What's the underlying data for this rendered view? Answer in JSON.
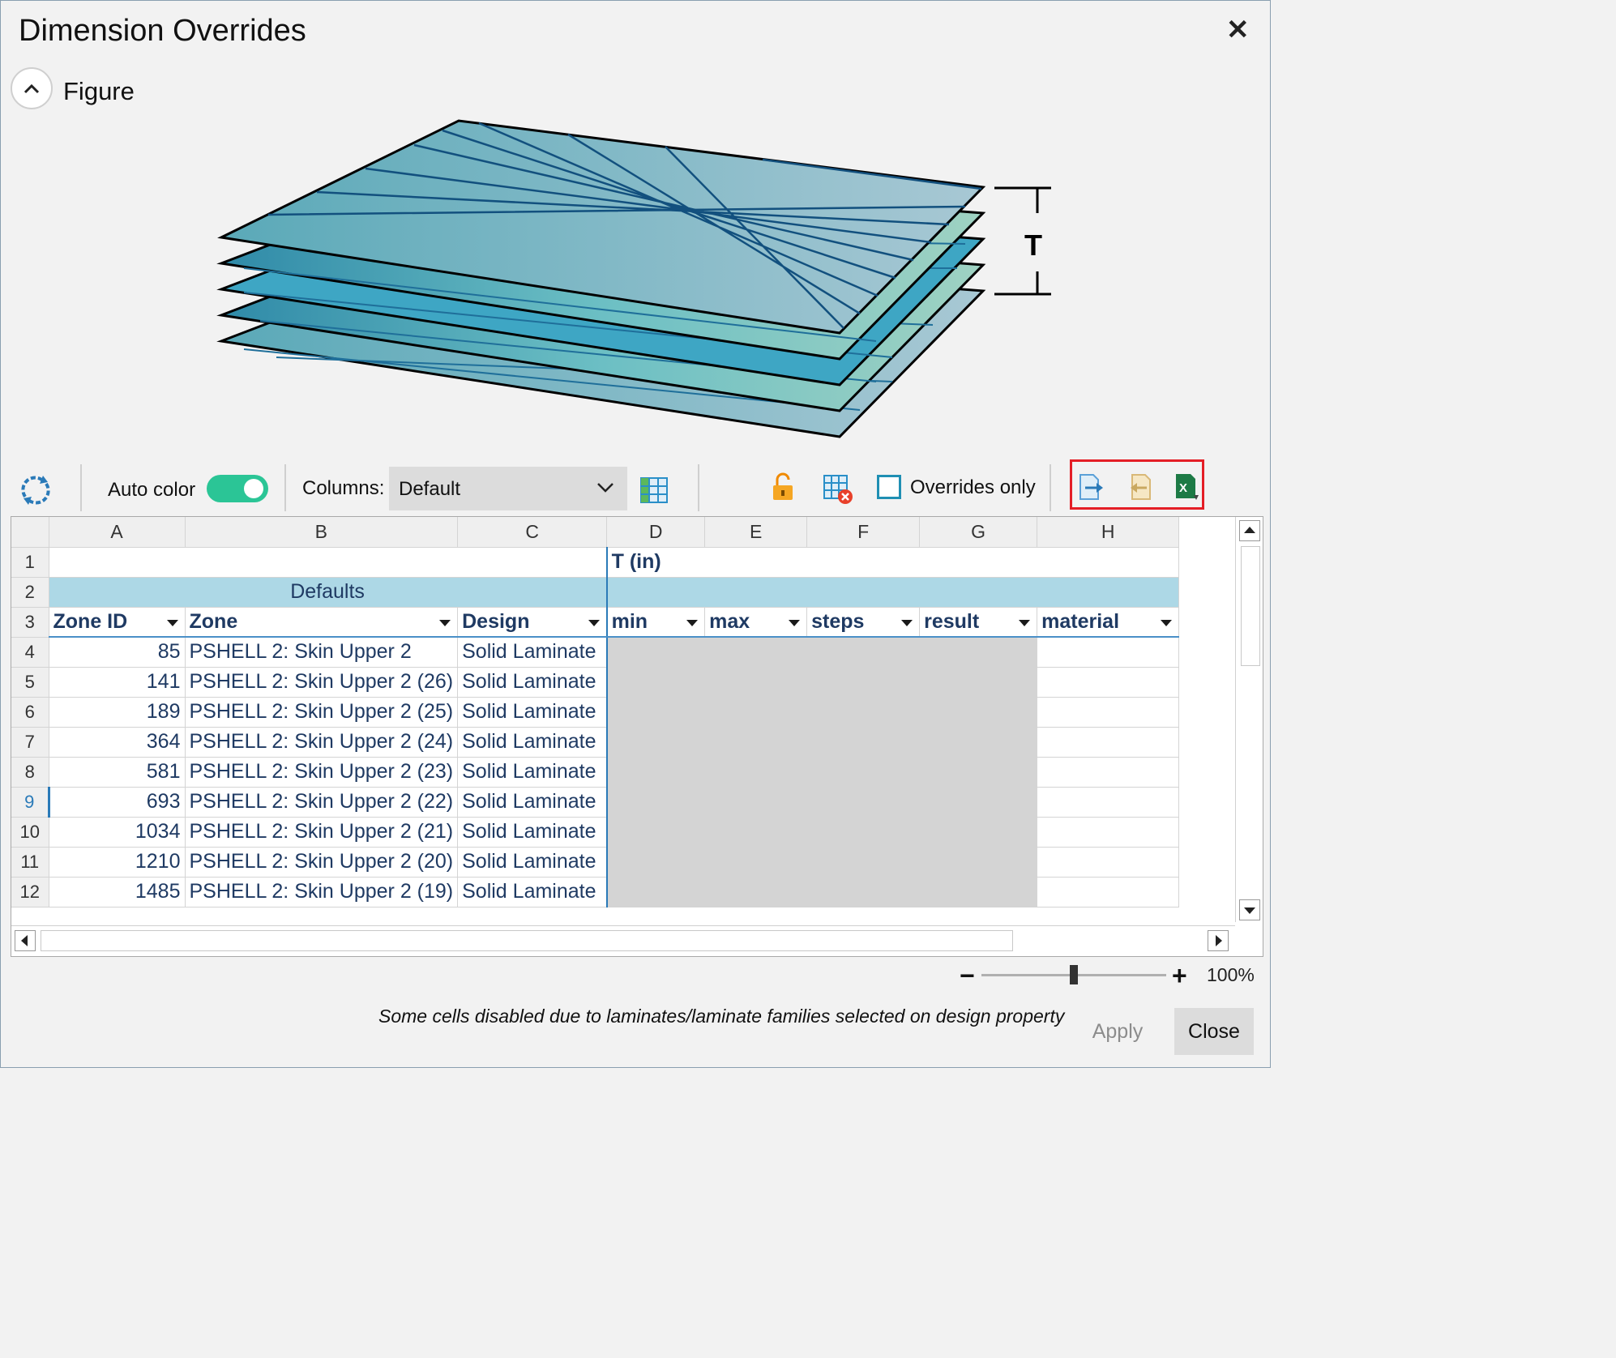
{
  "dialog": {
    "title": "Dimension Overrides"
  },
  "figure_section": {
    "label": "Figure",
    "dimension_label": "T"
  },
  "toolbar": {
    "auto_color_label": "Auto color",
    "auto_color_on": true,
    "columns_label": "Columns:",
    "columns_value": "Default",
    "overrides_only_label": "Overrides only"
  },
  "grid": {
    "column_letters": [
      "A",
      "B",
      "C",
      "D",
      "E",
      "F",
      "G",
      "H"
    ],
    "group_header": "T (in)",
    "defaults_label": "Defaults",
    "field_headers": [
      "Zone ID",
      "Zone",
      "Design",
      "min",
      "max",
      "steps",
      "result",
      "material"
    ],
    "rows": [
      {
        "row": "4",
        "zone_id": "85",
        "zone": "PSHELL 2: Skin Upper 2",
        "design": "Solid Laminate"
      },
      {
        "row": "5",
        "zone_id": "141",
        "zone": "PSHELL 2: Skin Upper 2 (26)",
        "design": "Solid Laminate"
      },
      {
        "row": "6",
        "zone_id": "189",
        "zone": "PSHELL 2: Skin Upper 2 (25)",
        "design": "Solid Laminate"
      },
      {
        "row": "7",
        "zone_id": "364",
        "zone": "PSHELL 2: Skin Upper 2 (24)",
        "design": "Solid Laminate"
      },
      {
        "row": "8",
        "zone_id": "581",
        "zone": "PSHELL 2: Skin Upper 2 (23)",
        "design": "Solid Laminate"
      },
      {
        "row": "9",
        "zone_id": "693",
        "zone": "PSHELL 2: Skin Upper 2 (22)",
        "design": "Solid Laminate"
      },
      {
        "row": "10",
        "zone_id": "1034",
        "zone": "PSHELL 2: Skin Upper 2 (21)",
        "design": "Solid Laminate"
      },
      {
        "row": "11",
        "zone_id": "1210",
        "zone": "PSHELL 2: Skin Upper 2 (20)",
        "design": "Solid Laminate"
      },
      {
        "row": "12",
        "zone_id": "1485",
        "zone": "PSHELL 2: Skin Upper 2 (19)",
        "design": "Solid Laminate"
      }
    ],
    "header_row_numbers": [
      "1",
      "2",
      "3"
    ],
    "selected_row": "9"
  },
  "zoom": {
    "value": "100%",
    "level_percent": 100
  },
  "footer": {
    "note": "Some cells disabled due to laminates/laminate families selected on design property",
    "apply_label": "Apply",
    "close_label": "Close"
  },
  "colors": {
    "accent": "#2a7ab8",
    "toggle": "#2bc596",
    "highlight_box": "#e41e26",
    "defaults_band": "#add8e6"
  },
  "icons": [
    "close-icon",
    "chevron-up-icon",
    "refresh-icon",
    "column-grid-icon",
    "unlock-icon",
    "clear-grid-icon",
    "export-icon",
    "import-icon",
    "excel-icon"
  ]
}
